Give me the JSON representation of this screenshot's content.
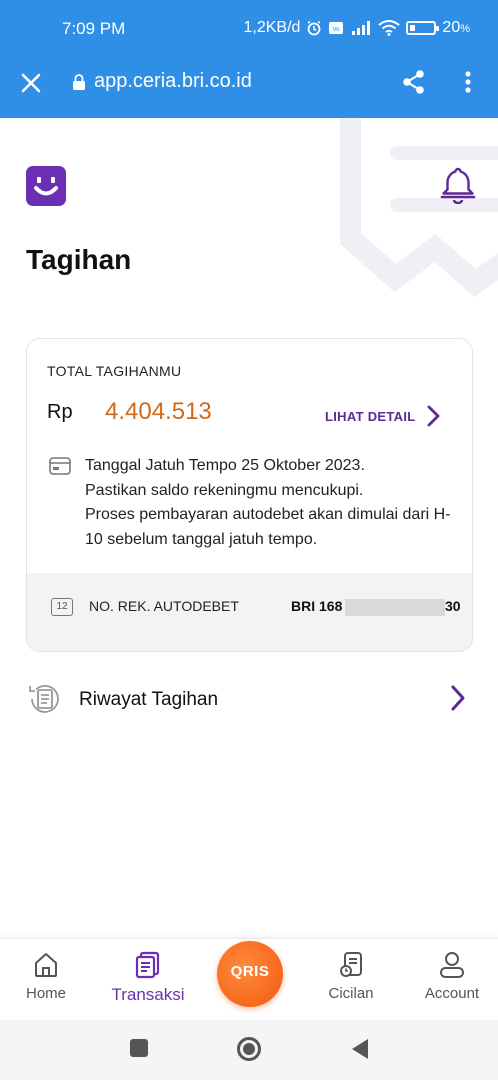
{
  "status_bar": {
    "time": "7:09 PM",
    "network_speed": "1,2KB/d",
    "battery": "20",
    "battery_unit": "%",
    "icons": [
      "alarm-icon",
      "volte-icon",
      "signal-icon",
      "wifi-icon",
      "battery-icon"
    ]
  },
  "browser": {
    "url": "app.ceria.bri.co.id",
    "icons": [
      "close-icon",
      "lock-icon",
      "share-icon",
      "more-vert-icon"
    ]
  },
  "header": {
    "title": "Tagihan",
    "icons": [
      "ceria-logo-icon",
      "bell-icon"
    ]
  },
  "bill_card": {
    "label": "TOTAL TAGIHANMU",
    "currency": "Rp",
    "amount": "4.404.513",
    "detail_link": "LIHAT DETAIL",
    "info_lines": [
      "Tanggal Jatuh Tempo 25 Oktober 2023.",
      "Pastikan saldo rekeningmu mencukupi.",
      "Proses pembayaran autodebet akan dimulai dari H-10 sebelum tanggal jatuh tempo."
    ],
    "account": {
      "calendar_day": "12",
      "label": "NO. REK. AUTODEBET",
      "value_prefix": "BRI 168",
      "value_suffix": "30"
    },
    "colors": {
      "amount": "#d06a1a",
      "accent": "#5b2a93"
    }
  },
  "history": {
    "label": "Riwayat Tagihan",
    "icons": [
      "history-receipt-icon",
      "chevron-right-icon"
    ]
  },
  "bottom_nav": {
    "items": [
      {
        "label": "Home",
        "icon": "home-icon",
        "active": false
      },
      {
        "label": "Transaksi",
        "icon": "transaction-icon",
        "active": true
      },
      {
        "label": "QRIS",
        "icon": "qris-icon",
        "active": false
      },
      {
        "label": "Cicilan",
        "icon": "installment-icon",
        "active": false
      },
      {
        "label": "Account",
        "icon": "account-icon",
        "active": false
      }
    ],
    "colors": {
      "active": "#6b2fb3",
      "qris": "#f25a0e"
    }
  },
  "system_nav": {
    "icons": [
      "recents-icon",
      "home-circle-icon",
      "back-icon"
    ]
  }
}
